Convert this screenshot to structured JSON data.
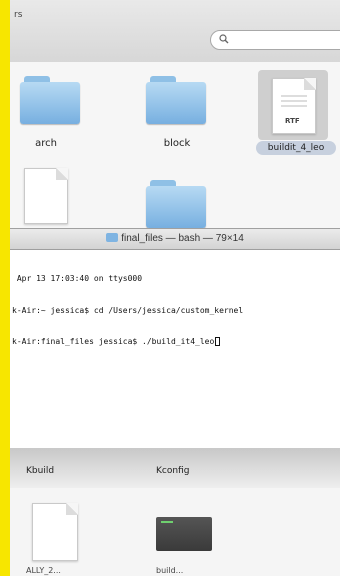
{
  "window": {
    "title_fragment": "rs"
  },
  "search": {
    "placeholder": "",
    "value": ""
  },
  "finder": {
    "top_items": [
      {
        "name": "arch",
        "type": "folder"
      },
      {
        "name": "block",
        "type": "folder"
      },
      {
        "name": "buildit_4_leo",
        "type": "rtf-document",
        "badge": "RTF",
        "selected": true
      }
    ],
    "second_row": [
      {
        "name": "",
        "type": "document"
      },
      {
        "name": "",
        "type": "folder"
      }
    ]
  },
  "terminal": {
    "title": "final_files — bash — 79×14",
    "lines": [
      " Apr 13 17:03:40 on ttys000",
      "k-Air:~ jessica$ cd /Users/jessica/custom_kernel",
      "k-Air:final_files jessica$ ./build_it4_leo"
    ]
  },
  "bottom": {
    "labels": [
      "Kbuild",
      "Kconfig"
    ],
    "fragments": [
      "ALLY_2...",
      "build..."
    ]
  },
  "colors": {
    "frame": "#f7e600",
    "folder": "#8fc0e6",
    "selection": "#c7d0de"
  }
}
